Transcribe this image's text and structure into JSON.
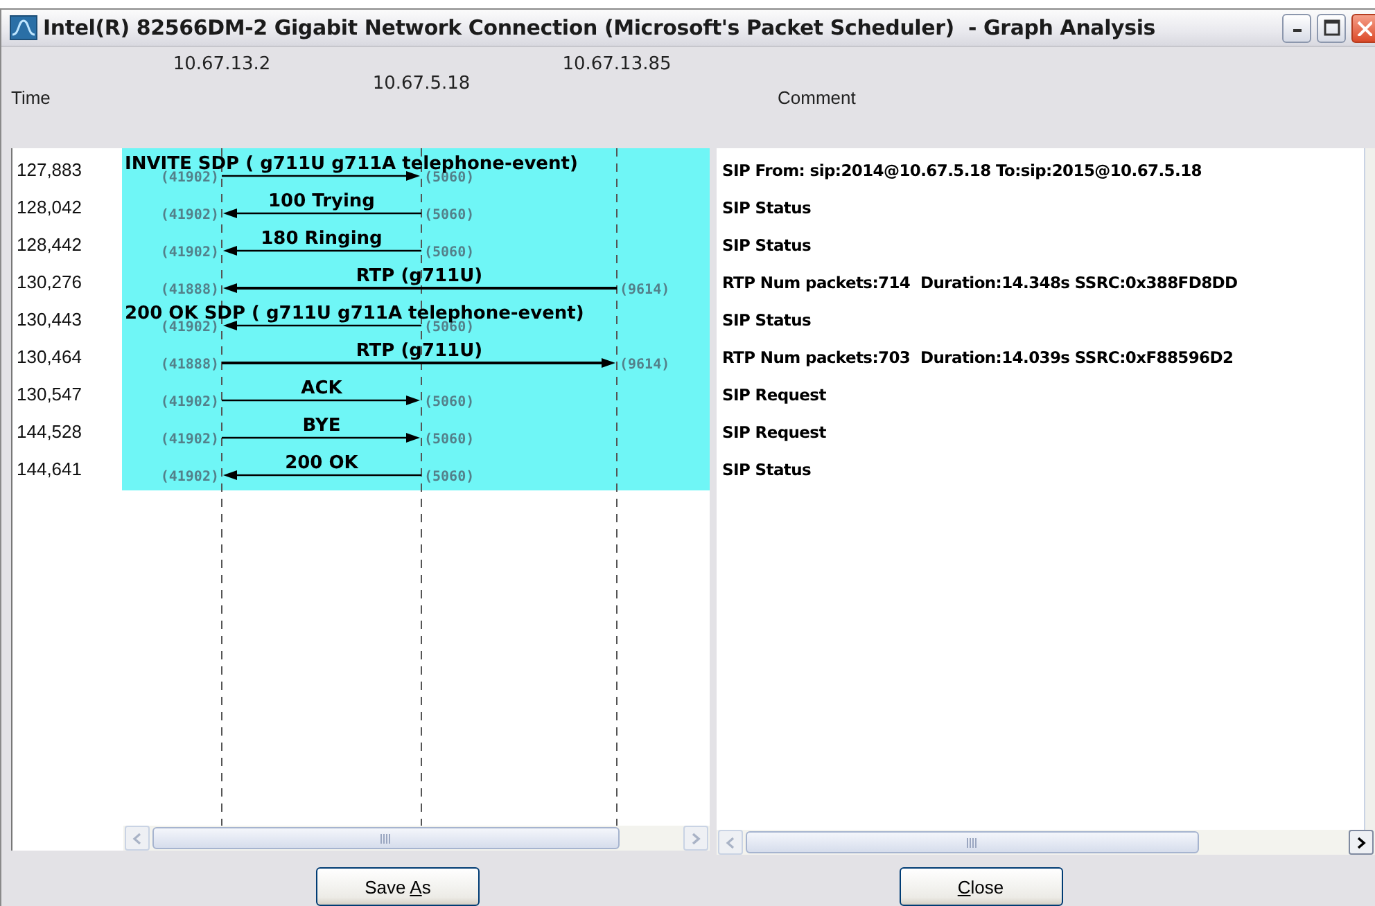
{
  "window": {
    "title": "Intel(R) 82566DM-2 Gigabit Network Connection (Microsoft's Packet Scheduler)  - Graph Analysis"
  },
  "columns": {
    "time": "Time",
    "comment": "Comment"
  },
  "nodes": [
    {
      "label": "10.67.13.2"
    },
    {
      "label": "10.67.5.18"
    },
    {
      "label": "10.67.13.85"
    }
  ],
  "rows": [
    {
      "time": "127,883",
      "message": "INVITE SDP ( g711U g711A telephone-event)",
      "spans_far_host": false,
      "points_right": true,
      "left_port": "(41902)",
      "right_port": "(5060)",
      "comment": "SIP From: sip:2014@10.67.5.18 To:sip:2015@10.67.5.18"
    },
    {
      "time": "128,042",
      "message": "100 Trying",
      "spans_far_host": false,
      "points_right": false,
      "left_port": "(41902)",
      "right_port": "(5060)",
      "comment": "SIP Status"
    },
    {
      "time": "128,442",
      "message": "180 Ringing",
      "spans_far_host": false,
      "points_right": false,
      "left_port": "(41902)",
      "right_port": "(5060)",
      "comment": "SIP Status"
    },
    {
      "time": "130,276",
      "message": "RTP (g711U)",
      "spans_far_host": true,
      "points_right": false,
      "left_port": "(41888)",
      "right_port": "(9614)",
      "comment": "RTP Num packets:714  Duration:14.348s SSRC:0x388FD8DD"
    },
    {
      "time": "130,443",
      "message": "200 OK SDP ( g711U g711A telephone-event)",
      "spans_far_host": false,
      "points_right": false,
      "left_port": "(41902)",
      "right_port": "(5060)",
      "comment": "SIP Status"
    },
    {
      "time": "130,464",
      "message": "RTP (g711U)",
      "spans_far_host": true,
      "points_right": true,
      "left_port": "(41888)",
      "right_port": "(9614)",
      "comment": "RTP Num packets:703  Duration:14.039s SSRC:0xF88596D2"
    },
    {
      "time": "130,547",
      "message": "ACK",
      "spans_far_host": false,
      "points_right": true,
      "left_port": "(41902)",
      "right_port": "(5060)",
      "comment": "SIP Request"
    },
    {
      "time": "144,528",
      "message": "BYE",
      "spans_far_host": false,
      "points_right": true,
      "left_port": "(41902)",
      "right_port": "(5060)",
      "comment": "SIP Request"
    },
    {
      "time": "144,641",
      "message": "200 OK",
      "spans_far_host": false,
      "points_right": false,
      "left_port": "(41902)",
      "right_port": "(5060)",
      "comment": "SIP Status"
    }
  ],
  "buttons": [
    {
      "label_start": "Save ",
      "access_key": "A",
      "label_end": "s"
    },
    {
      "access_key": "C",
      "label_end": "lose"
    }
  ]
}
